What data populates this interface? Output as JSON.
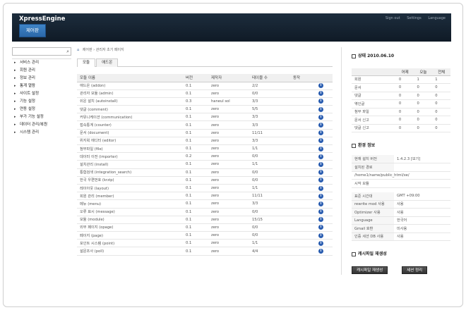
{
  "header": {
    "brand": "XpressEngine",
    "admin_button": "제어판",
    "links": [
      "Sign out",
      "Settings",
      "Language"
    ]
  },
  "sidebar": {
    "search_placeholder": "",
    "items": [
      "서비스 관리",
      "회원 관리",
      "정보 관리",
      "통계 열람",
      "사이트 설정",
      "기능 설정",
      "연동 설정",
      "부가 기능 설정",
      "데이터 관리/복원",
      "시스템 관리"
    ]
  },
  "main": {
    "breadcrumb": [
      "제어판",
      "관리자 초기 페이지"
    ],
    "tabs": [
      "모듈",
      "애드온"
    ],
    "columns": [
      "모듈 이름",
      "버전",
      "제작자",
      "테이블 수",
      "동작"
    ],
    "rows": [
      [
        "애드온 (addon)",
        "0.1",
        "zero",
        "2/2"
      ],
      [
        "관리자 모듈 (admin)",
        "0.1",
        "zero",
        "0/0"
      ],
      [
        "쉬운 설치 (autoinstall)",
        "0.3",
        "haneul sol",
        "3/3"
      ],
      [
        "댓글 (comment)",
        "0.1",
        "zero",
        "5/5"
      ],
      [
        "커뮤니케이션 (communication)",
        "0.1",
        "zero",
        "3/3"
      ],
      [
        "접속통계 (counter)",
        "0.1",
        "zero",
        "3/3"
      ],
      [
        "문서 (document)",
        "0.1",
        "zero",
        "11/11"
      ],
      [
        "위지윅 에디터 (editor)",
        "0.1",
        "zero",
        "3/3"
      ],
      [
        "첨부파일 (file)",
        "0.1",
        "zero",
        "1/1"
      ],
      [
        "데이터 이전 (importer)",
        "0.2",
        "zero",
        "0/0"
      ],
      [
        "설치관리 (install)",
        "0.1",
        "zero",
        "1/1"
      ],
      [
        "통합검색 (integration_search)",
        "0.1",
        "zero",
        "0/0"
      ],
      [
        "한국 우편번호 (krzip)",
        "0.1",
        "zero",
        "0/0"
      ],
      [
        "레이아웃 (layout)",
        "0.1",
        "zero",
        "1/1"
      ],
      [
        "회원 관리 (member)",
        "0.1",
        "zero",
        "11/11"
      ],
      [
        "메뉴 (menu)",
        "0.1",
        "zero",
        "3/3"
      ],
      [
        "오류 표시 (message)",
        "0.1",
        "zero",
        "0/0"
      ],
      [
        "모듈 (module)",
        "0.1",
        "zero",
        "15/15"
      ],
      [
        "외부 페이지 (opage)",
        "0.1",
        "zero",
        "0/0"
      ],
      [
        "페이지 (page)",
        "0.1",
        "zero",
        "0/0"
      ],
      [
        "포인트 시스템 (point)",
        "0.1",
        "zero",
        "1/1"
      ],
      [
        "설문조사 (poll)",
        "0.1",
        "zero",
        "4/4"
      ]
    ]
  },
  "status": {
    "title": "상태 2010.06.10",
    "columns": [
      "",
      "어제",
      "오늘",
      "전체"
    ],
    "rows": [
      [
        "회원",
        "0",
        "1",
        "1"
      ],
      [
        "문서",
        "0",
        "0",
        "0"
      ],
      [
        "댓글",
        "0",
        "0",
        "0"
      ],
      [
        "엮인글",
        "0",
        "0",
        "0"
      ],
      [
        "첨부 파일",
        "0",
        "0",
        "0"
      ],
      [
        "문서 신고",
        "0",
        "0",
        "0"
      ],
      [
        "댓글 신고",
        "0",
        "0",
        "0"
      ]
    ]
  },
  "environment": {
    "title": "환경 정보",
    "rows_a": [
      [
        "현재 설치 버전",
        "1.4.2.3 [보기]"
      ],
      [
        "설치된 경로",
        ""
      ]
    ],
    "path": "/home1/name/public_html/xe/",
    "installed_modules": "시작 모듈",
    "rows_b": [
      [
        "표준 시간대",
        "GMT +09:00"
      ],
      [
        "rewrite mod 사용",
        "사용"
      ],
      [
        "Optimizer 사용",
        "사용"
      ],
      [
        "Language",
        "한국어"
      ],
      [
        "Gmail 호환",
        "미사용"
      ],
      [
        "인증 세션 DB 사용",
        "사용"
      ]
    ]
  },
  "cache": {
    "title": "캐시파일 재생성",
    "regen_button": "캐시파일 재생성",
    "session_button": "세션 정리"
  }
}
